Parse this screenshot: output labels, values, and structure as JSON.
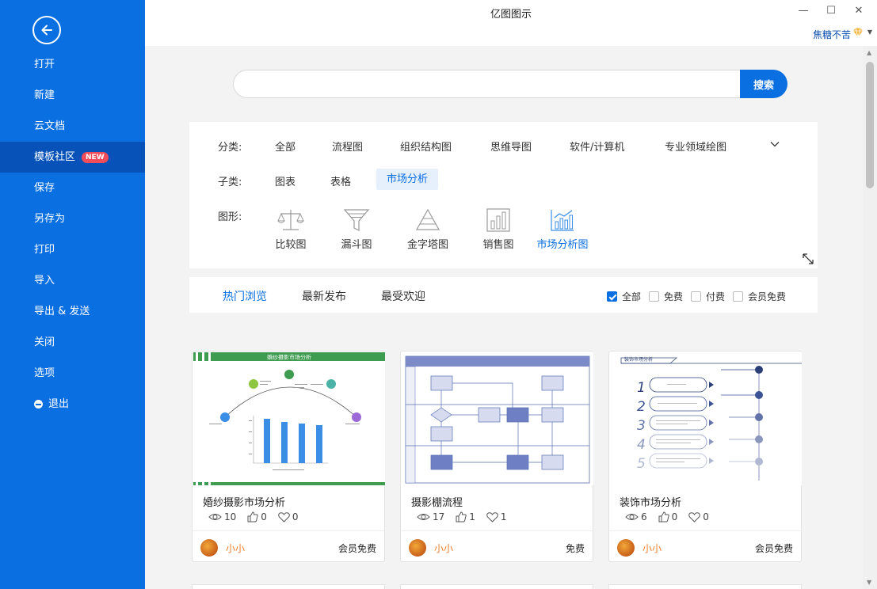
{
  "app": {
    "title": "亿图图示"
  },
  "window": {
    "minimize": "—",
    "maximize": "☐",
    "close": "✕"
  },
  "user": {
    "name": "焦糖不苦"
  },
  "sidebar": {
    "items": [
      {
        "label": "打开"
      },
      {
        "label": "新建"
      },
      {
        "label": "云文档"
      },
      {
        "label": "模板社区",
        "badge": "NEW",
        "active": true
      },
      {
        "label": "保存"
      },
      {
        "label": "另存为"
      },
      {
        "label": "打印"
      },
      {
        "label": "导入"
      },
      {
        "label": "导出 & 发送"
      },
      {
        "label": "关闭"
      },
      {
        "label": "选项"
      },
      {
        "label": "退出"
      }
    ]
  },
  "search": {
    "placeholder": "",
    "value": "",
    "button": "搜索"
  },
  "filters": {
    "category_label": "分类:",
    "categories": [
      "全部",
      "流程图",
      "组织结构图",
      "思维导图",
      "软件/计算机",
      "专业领域绘图"
    ],
    "sub_label": "子类:",
    "subcategories": [
      "图表",
      "表格",
      "市场分析"
    ],
    "sub_selected": "市场分析",
    "shape_label": "图形:",
    "shapes": [
      "比较图",
      "漏斗图",
      "金字塔图",
      "销售图",
      "市场分析图"
    ],
    "shape_selected": "市场分析图"
  },
  "sort_tabs": [
    "热门浏览",
    "最新发布",
    "最受欢迎"
  ],
  "price_filters": [
    {
      "label": "全部",
      "checked": true
    },
    {
      "label": "免费",
      "checked": false
    },
    {
      "label": "付费",
      "checked": false
    },
    {
      "label": "会员免费",
      "checked": false
    }
  ],
  "cards": [
    {
      "title": "婚纱摄影市场分析",
      "thumb_title": "婚纱摄影市场分析",
      "views": "10",
      "likes": "0",
      "favorites": "0",
      "author": "小小",
      "price": "会员免费"
    },
    {
      "title": "摄影棚流程",
      "thumb_title": "",
      "views": "17",
      "likes": "1",
      "favorites": "1",
      "author": "小小",
      "price": "免费"
    },
    {
      "title": "装饰市场分析",
      "thumb_title": "装饰市场分析",
      "views": "6",
      "likes": "0",
      "favorites": "0",
      "author": "小小",
      "price": "会员免费"
    }
  ],
  "colors": {
    "accent": "#0a6fe0",
    "sidebar": "#0a6fe0",
    "sidebar_active": "#0652b8",
    "badge": "#f04d5a",
    "author": "#f07d2a",
    "wedding_green": "#3d9c4f"
  }
}
